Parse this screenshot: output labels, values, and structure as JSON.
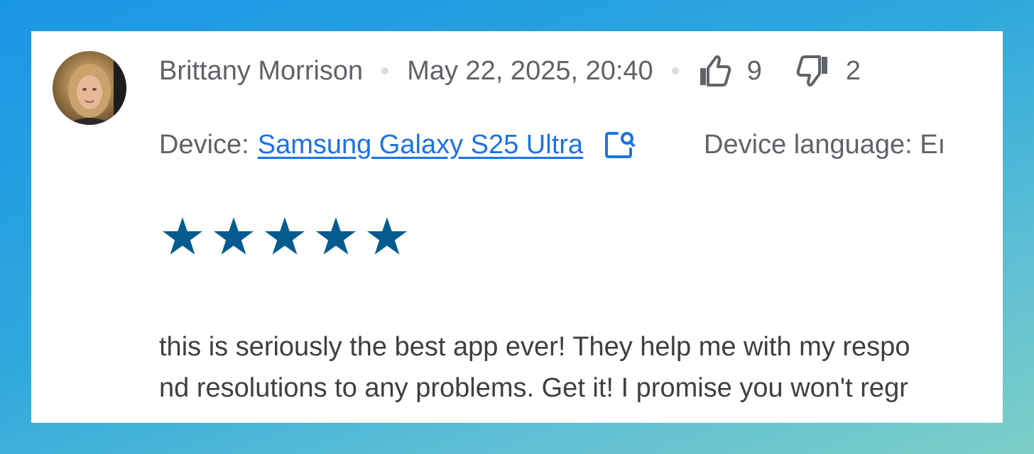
{
  "review": {
    "author": "Brittany Morrison",
    "datetime": "May 22, 2025, 20:40",
    "likes": "9",
    "dislikes": "2",
    "device_label": "Device:",
    "device_name": "Samsung Galaxy S25 Ultra",
    "device_language_label": "Device language: Eı",
    "rating": 5,
    "text_line1": "this is seriously the best app ever! They help me with my respo",
    "text_line2": "nd resolutions to any problems. Get it! I promise you won't regr"
  },
  "icons": {
    "like": "thumbs-up-icon",
    "dislike": "thumbs-down-icon",
    "device_lookup": "open-in-search-icon",
    "star": "star-icon"
  },
  "colors": {
    "star": "#055b8f",
    "link": "#1a73e8",
    "meta_text": "#5f6368",
    "body_text": "#3c4043"
  }
}
